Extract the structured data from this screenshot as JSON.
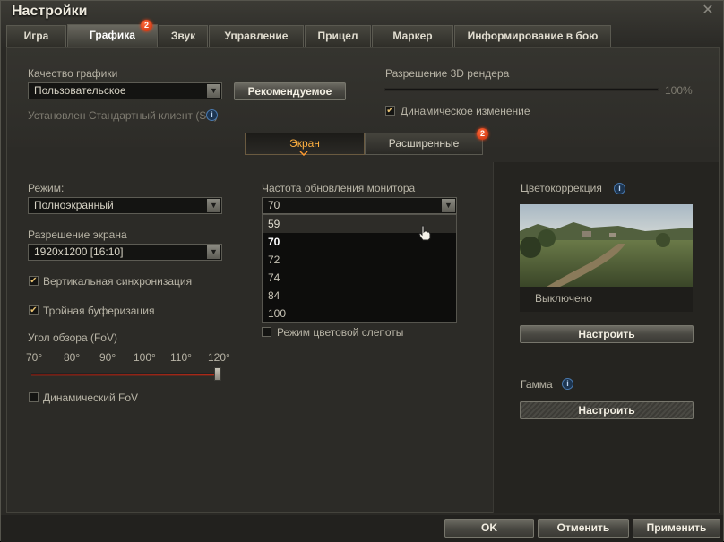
{
  "window": {
    "title": "Настройки",
    "close_glyph": "✕"
  },
  "tabs": [
    {
      "label": "Игра",
      "active": false
    },
    {
      "label": "Графика",
      "active": true,
      "badge": "2"
    },
    {
      "label": "Звук",
      "active": false
    },
    {
      "label": "Управление",
      "active": false
    },
    {
      "label": "Прицел",
      "active": false
    },
    {
      "label": "Маркер",
      "active": false
    },
    {
      "label": "Информирование в бою",
      "active": false
    }
  ],
  "graphics_quality": {
    "label": "Качество графики",
    "value": "Пользовательское",
    "recommended_button": "Рекомендуемое",
    "client_note": "Установлен Стандартный клиент (SD)"
  },
  "render_resolution": {
    "label": "Разрешение 3D рендера",
    "value_text": "100%",
    "value": 1.0,
    "dynamic_label": "Динамическое изменение",
    "dynamic_checked": true
  },
  "subtabs": [
    {
      "label": "Экран",
      "active": true
    },
    {
      "label": "Расширенные",
      "active": false,
      "badge": "2"
    }
  ],
  "screen": {
    "mode_label": "Режим:",
    "mode_value": "Полноэкранный",
    "resolution_label": "Разрешение экрана",
    "resolution_value": "1920x1200 [16:10]",
    "vsync_label": "Вертикальная синхронизация",
    "vsync_checked": true,
    "triple_label": "Тройная буферизация",
    "triple_checked": true,
    "fov_label": "Угол обзора (FoV)",
    "fov_ticks": [
      "70°",
      "80°",
      "90°",
      "100°",
      "110°",
      "120°"
    ],
    "fov_value": 120,
    "dynamic_fov_label": "Динамический FoV",
    "dynamic_fov_checked": false
  },
  "refresh": {
    "label": "Частота обновления монитора",
    "value": "70",
    "options": [
      "59",
      "70",
      "72",
      "74",
      "84",
      "100"
    ],
    "hovered": "59",
    "selected": "70"
  },
  "colorblind": {
    "label": "Режим цветовой слепоты",
    "checked": false
  },
  "color_correction": {
    "label": "Цветокоррекция",
    "status": "Выключено",
    "button": "Настроить"
  },
  "gamma": {
    "label": "Гамма",
    "button": "Настроить"
  },
  "footer": {
    "ok": "OK",
    "cancel": "Отменить",
    "apply": "Применить"
  },
  "icons": {
    "info": "i",
    "check": "✔",
    "arrow": "▼"
  },
  "colors": {
    "accent": "#ffb040",
    "badge": "#e03c14",
    "slider": "#b02a18"
  }
}
